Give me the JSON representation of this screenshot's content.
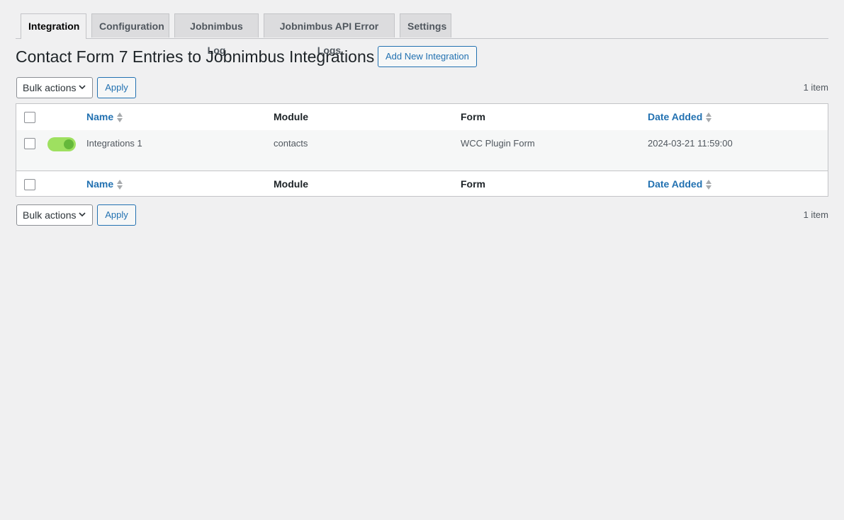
{
  "tabs": [
    {
      "label": "Integration",
      "active": true
    },
    {
      "label": "Configuration",
      "active": false
    },
    {
      "label": "Jobnimbus Log",
      "active": false
    },
    {
      "label": "Jobnimbus API Error Logs",
      "active": false
    },
    {
      "label": "Settings",
      "active": false
    }
  ],
  "page": {
    "title": "Contact Form 7 Entries to Jobnimbus Integrations",
    "add_new_label": "Add New Integration"
  },
  "tablenav": {
    "bulk_actions_label": "Bulk actions",
    "apply_label": "Apply",
    "item_count": "1 item"
  },
  "table": {
    "columns": {
      "name": "Name",
      "module": "Module",
      "form": "Form",
      "date_added": "Date Added"
    },
    "rows": [
      {
        "enabled": true,
        "name": "Integrations 1",
        "module": "contacts",
        "form": "WCC Plugin Form",
        "date_added": "2024-03-21 11:59:00"
      }
    ]
  },
  "colors": {
    "accent": "#2271b1",
    "toggle_on": "#9ee060",
    "background": "#f0f0f1"
  }
}
